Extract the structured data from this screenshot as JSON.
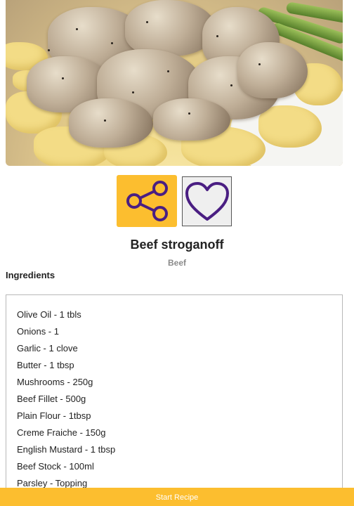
{
  "recipe": {
    "title": "Beef stroganoff",
    "category": "Beef"
  },
  "hero_image": {
    "subject": "Beef stroganoff served on egg noodles with asparagus"
  },
  "actions": {
    "share_icon": "share-icon",
    "favorite_icon": "heart-icon"
  },
  "ingredients": {
    "heading": "Ingredients",
    "items": [
      "Olive Oil - 1 tbls",
      "Onions - 1",
      "Garlic - 1 clove",
      "Butter - 1 tbsp",
      "Mushrooms - 250g",
      "Beef Fillet - 500g",
      "Plain Flour - 1tbsp",
      "Creme Fraiche - 150g",
      "English Mustard - 1 tbsp",
      "Beef Stock - 100ml",
      "Parsley - Topping"
    ]
  },
  "footer": {
    "start_label": "Start Recipe"
  },
  "colors": {
    "accent": "#fcbe2f",
    "icon_purple": "#4a1e82",
    "muted_text": "#8a8a8a"
  }
}
